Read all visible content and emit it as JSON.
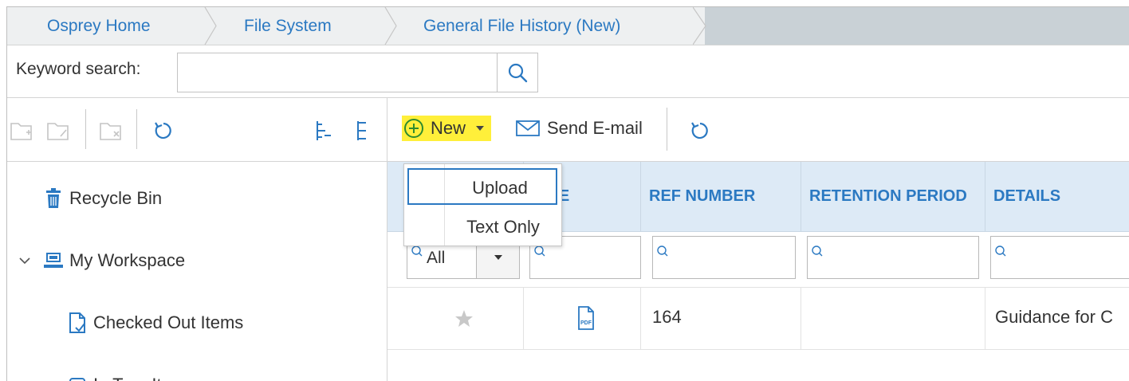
{
  "breadcrumb": {
    "items": [
      "Osprey Home",
      "File System",
      "General File History (New)"
    ]
  },
  "search": {
    "label": "Keyword search:",
    "value": "",
    "placeholder": ""
  },
  "tree": {
    "items": [
      {
        "label": "Recycle Bin",
        "icon": "recycle-bin-icon"
      },
      {
        "label": "My Workspace",
        "icon": "workspace-icon",
        "expanded": true
      },
      {
        "label": "Checked Out Items",
        "icon": "checked-out-icon"
      },
      {
        "label": "In Tray Items",
        "icon": "in-tray-icon"
      }
    ]
  },
  "toolbar": {
    "new_label": "New",
    "send_email_label": "Send E-mail"
  },
  "new_menu": {
    "items": [
      "Upload",
      "Text Only"
    ]
  },
  "grid": {
    "columns": [
      "TYPE",
      "REF NUMBER",
      "RETENTION PERIOD",
      "DETAILS"
    ],
    "filter_all_label": "All",
    "rows": [
      {
        "starred": false,
        "type_icon": "pdf-icon",
        "ref_number": "164",
        "retention_period": "",
        "details": "Guidance for C"
      }
    ]
  },
  "colors": {
    "accent": "#2b79c2",
    "highlight": "#ffef3a",
    "header_bg": "#ddeaf6",
    "breadcrumb_bg": "#eef0f1",
    "new_icon_green": "#2e8b2e"
  }
}
